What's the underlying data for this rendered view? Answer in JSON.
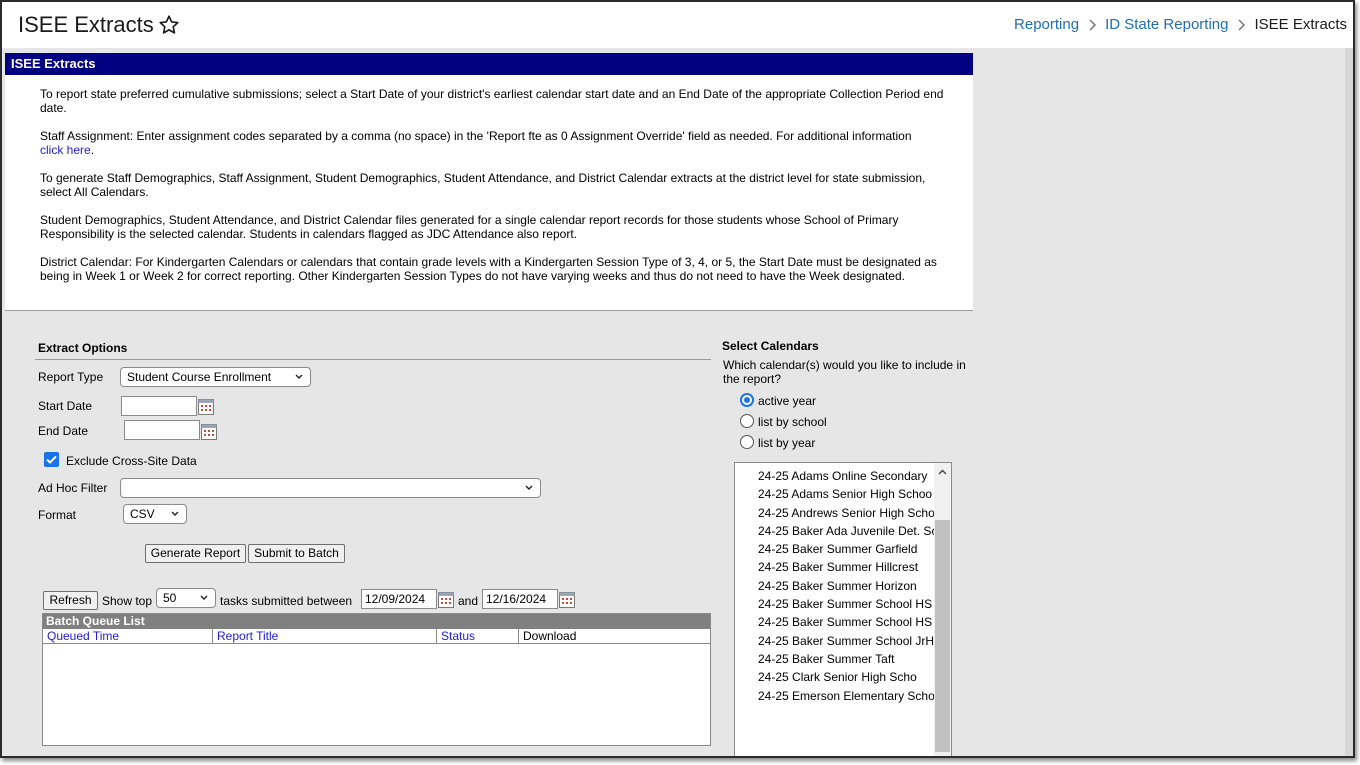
{
  "header": {
    "title": "ISEE Extracts",
    "breadcrumb": [
      "Reporting",
      "ID State Reporting",
      "ISEE Extracts"
    ]
  },
  "panel": {
    "heading": "ISEE Extracts",
    "paragraphs": {
      "p1": "To report state preferred cumulative submissions; select a Start Date of your district's earliest calendar start date and an End Date of the appropriate Collection Period end date.",
      "p2": "Staff Assignment: Enter assignment codes separated by a comma (no space) in the 'Report fte as 0 Assignment Override' field as needed. For additional information",
      "p2_link": "click here",
      "p2_end": ".",
      "p3": "To generate Staff Demographics, Staff Assignment, Student Demographics, Student Attendance, and District Calendar extracts at the district level for state submission, select All Calendars.",
      "p4": "Student Demographics, Student Attendance, and District Calendar files generated for a single calendar report records for those students whose School of Primary Responsibility is the selected calendar. Students in calendars flagged as JDC Attendance also report.",
      "p5": "District Calendar: For Kindergarten Calendars or calendars that contain grade levels with a Kindergarten Session Type of 3, 4, or 5, the Start Date must be designated as being in Week 1 or Week 2 for correct reporting. Other Kindergarten Session Types do not have varying weeks and thus do not need to have the Week designated."
    }
  },
  "extract": {
    "title": "Extract Options",
    "report_type_label": "Report Type",
    "report_type_value": "Student Course Enrollment",
    "start_date_label": "Start Date",
    "start_date_value": "",
    "end_date_label": "End Date",
    "end_date_value": "",
    "exclude_label": "Exclude Cross-Site Data",
    "exclude_checked": true,
    "adhoc_label": "Ad Hoc Filter",
    "adhoc_value": "",
    "format_label": "Format",
    "format_value": "CSV",
    "generate_button": "Generate Report",
    "batch_button": "Submit to Batch"
  },
  "batch": {
    "refresh_button": "Refresh",
    "show_top_label": "Show top",
    "show_top_value": "50",
    "between_label": "tasks submitted between",
    "from_date": "12/09/2024",
    "and_label": "and",
    "to_date": "12/16/2024",
    "list_title": "Batch Queue List",
    "columns": [
      "Queued Time",
      "Report Title",
      "Status",
      "Download"
    ]
  },
  "calendars": {
    "title": "Select Calendars",
    "question": "Which calendar(s) would you like to include in the report?",
    "options": [
      "active year",
      "list by school",
      "list by year"
    ],
    "selected_option": "active year",
    "items": [
      "24-25 Adams Online Secondary",
      "24-25 Adams Senior High Schoo",
      "24-25 Andrews Senior High Scho",
      "24-25 Baker Ada Juvenile Det. Sc",
      "24-25 Baker Summer Garfield",
      "24-25 Baker Summer Hillcrest",
      "24-25 Baker Summer Horizon",
      "24-25 Baker Summer School HS",
      "24-25 Baker Summer School HS",
      "24-25 Baker Summer School JrH",
      "24-25 Baker Summer Taft",
      "24-25 Clark Senior High Scho",
      "24-25 Emerson Elementary Scho"
    ]
  },
  "colors": {
    "panel_header": "#000080",
    "link": "#1d1ddb",
    "breadcrumb_link": "#1f6fb2",
    "accent": "#1a73e8"
  }
}
